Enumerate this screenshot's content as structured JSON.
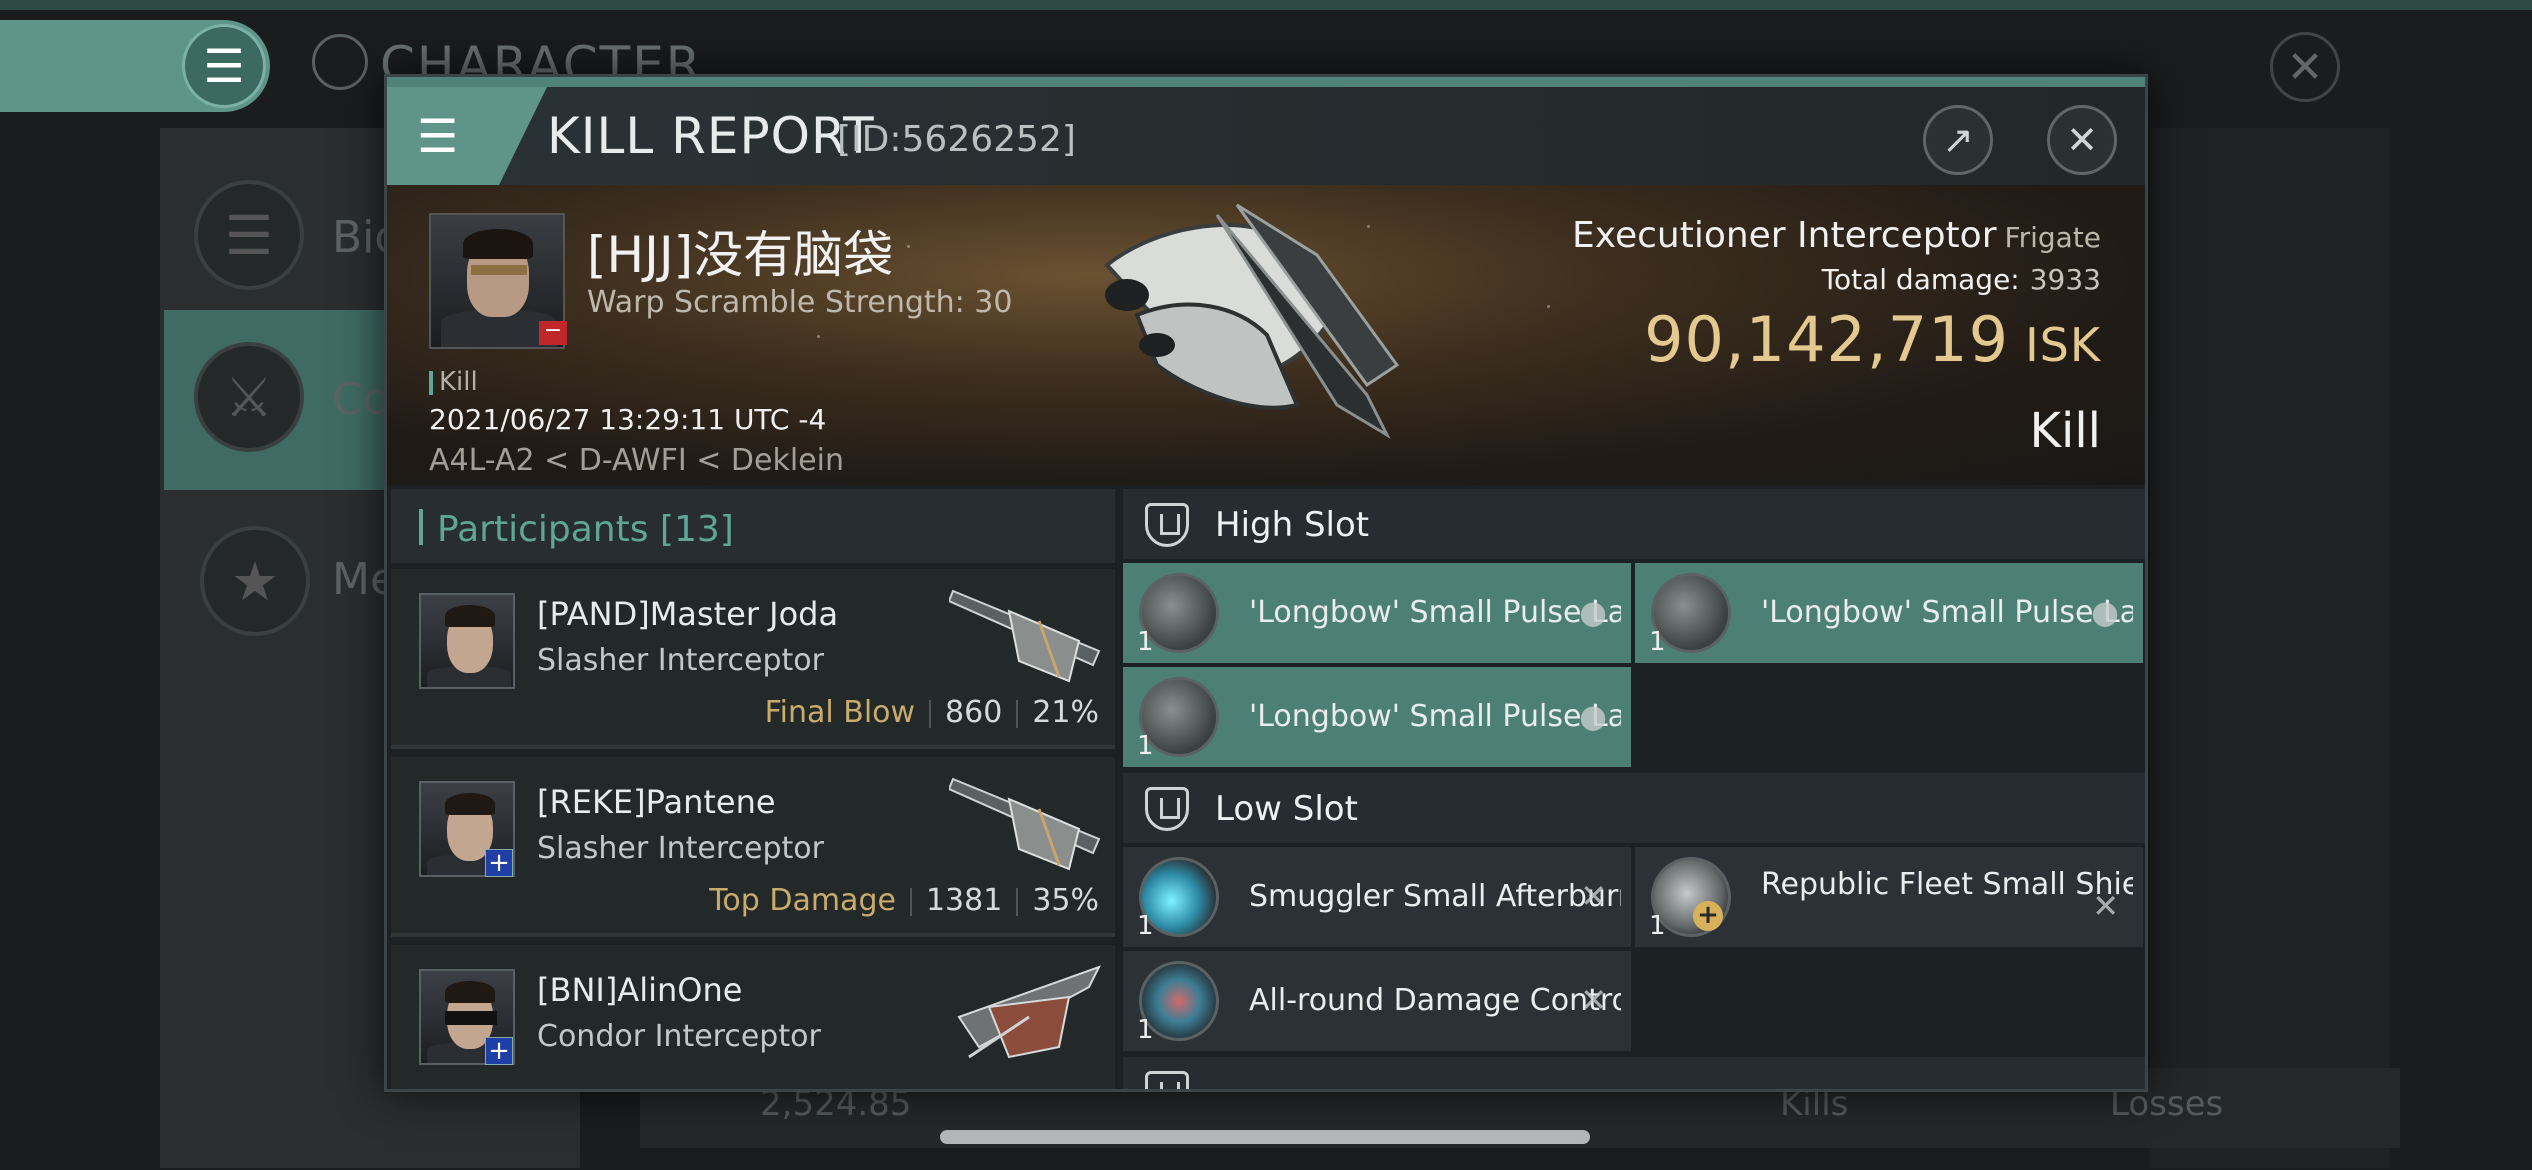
{
  "background": {
    "section_title": "CHARACTER",
    "side_items": [
      {
        "label": "Bio",
        "icon": "list-icon"
      },
      {
        "label": "Co",
        "icon": "swords-icon"
      },
      {
        "label": "Me",
        "icon": "star-icon"
      }
    ],
    "bottom": {
      "value": "2,524.85",
      "kills_label": "Kills",
      "losses_label": "Losses"
    }
  },
  "dialog": {
    "title": "KILL REPORT",
    "id_text": "[ID:5626252]",
    "victim": {
      "name": "[HJJ]没有脑袋",
      "warp_scramble": "Warp Scramble Strength: 30",
      "kill_label": "Kill",
      "datetime": "2021/06/27 13:29:11 UTC -4",
      "location": "A4L-A2 < D-AWFI < Deklein",
      "ship_name": "Executioner Interceptor",
      "ship_class": "Frigate",
      "total_damage_label": "Total damage:",
      "total_damage": "3933",
      "isk_value": "90,142,719",
      "isk_unit": "ISK",
      "result": "Kill"
    },
    "participants": {
      "header": "Participants [13]",
      "rows": [
        {
          "name": "[PAND]Master Joda",
          "ship": "Slasher Interceptor",
          "tag": "Final Blow",
          "damage": "860",
          "percent": "21%"
        },
        {
          "name": "[REKE]Pantene",
          "ship": "Slasher Interceptor",
          "tag": "Top Damage",
          "damage": "1381",
          "percent": "35%"
        },
        {
          "name": "[BNI]AlinOne",
          "ship": "Condor Interceptor",
          "tag": "",
          "damage": "",
          "percent": ""
        }
      ]
    },
    "fittings": {
      "high_slot_label": "High Slot",
      "low_slot_label": "Low Slot",
      "high": [
        {
          "name": "'Longbow' Small Pulse Laser",
          "qty": "1",
          "state": "active"
        },
        {
          "name": "'Longbow' Small Pulse Laser",
          "qty": "1",
          "state": "active"
        },
        {
          "name": "'Longbow' Small Pulse Laser",
          "qty": "1",
          "state": "active"
        }
      ],
      "low": [
        {
          "name": "Smuggler Small Afterburner",
          "qty": "1",
          "state": "destroyed"
        },
        {
          "name": "Republic Fleet Small Shield...",
          "qty": "1",
          "state": "destroyed"
        },
        {
          "name": "All-round Damage Control",
          "qty": "1",
          "state": "destroyed"
        }
      ]
    }
  },
  "colors": {
    "accent": "#5fa598",
    "isk_gold": "#e3c98f",
    "active_module": "#4d8074"
  }
}
